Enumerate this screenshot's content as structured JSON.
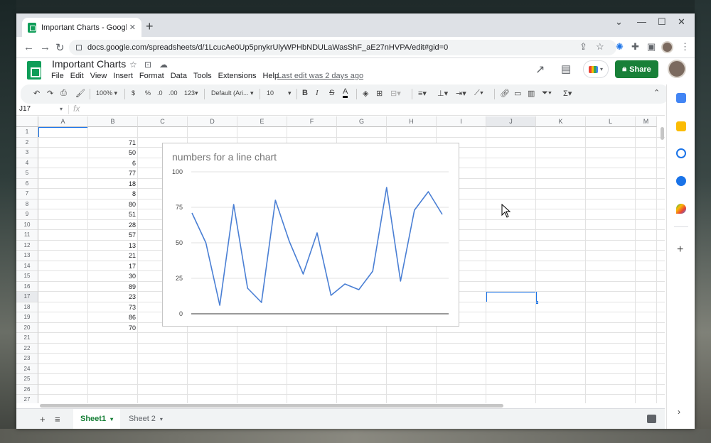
{
  "browser": {
    "tab_title": "Important Charts - Google Sheets",
    "new_tab_label": "+",
    "url": "docs.google.com/spreadsheets/d/1LcucAe0Up5pnykrUlyWPHbNDULaWasShF_aE27nHVPA/edit#gid=0"
  },
  "doc": {
    "title": "Important Charts",
    "menus": [
      "File",
      "Edit",
      "View",
      "Insert",
      "Format",
      "Data",
      "Tools",
      "Extensions",
      "Help"
    ],
    "last_edit": "Last edit was 2 days ago",
    "share_label": "Share"
  },
  "toolbar": {
    "zoom": "100%",
    "currency": "$",
    "percent": "%",
    "dec_decrease": ".0",
    "dec_increase": ".00",
    "more_formats": "123",
    "font": "Default (Ari...",
    "font_size": "10",
    "bold": "B",
    "italic": "I",
    "strike": "S",
    "text_color": "A",
    "functions": "Σ"
  },
  "formula_bar": {
    "name_box": "J17",
    "fx": "fx"
  },
  "grid": {
    "columns": [
      "A",
      "B",
      "C",
      "D",
      "E",
      "F",
      "G",
      "H",
      "I",
      "J",
      "K",
      "L",
      "M"
    ],
    "rows": [
      "1",
      "2",
      "3",
      "4",
      "5",
      "6",
      "7",
      "8",
      "9",
      "10",
      "11",
      "12",
      "13",
      "14",
      "15",
      "16",
      "17",
      "18",
      "19",
      "20",
      "21",
      "22",
      "23",
      "24",
      "25",
      "26",
      "27"
    ],
    "column_b_values": [
      null,
      "71",
      "50",
      "6",
      "77",
      "18",
      "8",
      "80",
      "51",
      "28",
      "57",
      "13",
      "21",
      "17",
      "30",
      "89",
      "23",
      "73",
      "86",
      "70"
    ],
    "selected_cell": "J17"
  },
  "chart_data": {
    "type": "line",
    "title": "numbers for a line chart",
    "x": [
      1,
      2,
      3,
      4,
      5,
      6,
      7,
      8,
      9,
      10,
      11,
      12,
      13,
      14,
      15,
      16,
      17,
      18,
      19
    ],
    "series": [
      {
        "values": [
          71,
          50,
          6,
          77,
          18,
          8,
          80,
          51,
          28,
          57,
          13,
          21,
          17,
          30,
          89,
          23,
          73,
          86,
          70
        ]
      }
    ],
    "ylim": [
      0,
      100
    ],
    "yticks": [
      "0",
      "25",
      "50",
      "75",
      "100"
    ],
    "grid": true,
    "line_color": "#4a7fd4"
  },
  "sheets": {
    "add_label": "+",
    "all_label": "≡",
    "tabs": [
      "Sheet1",
      "Sheet 2"
    ],
    "active": "Sheet1"
  }
}
